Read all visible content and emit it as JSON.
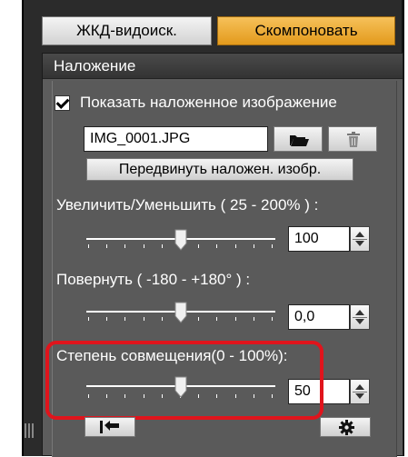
{
  "tabs": {
    "lcd": "ЖКД-видоиск.",
    "compose": "Скомпоновать"
  },
  "overlay": {
    "header": "Наложение",
    "show_overlay_label": "Показать наложенное изображение",
    "show_overlay_checked": true,
    "filename": "IMG_0001.JPG",
    "move_button": "Передвинуть наложен. изобр.",
    "zoom": {
      "label": "Увеличить/Уменьшить ( 25 - 200% ) :",
      "value": "100",
      "level_fraction": 0.5
    },
    "rotate": {
      "label": "Повернуть ( -180 - +180° ) :",
      "value": "0,0",
      "level_fraction": 0.5
    },
    "blend": {
      "label": "Степень совмещения(0 - 100%):",
      "value": "50",
      "level_fraction": 0.5
    }
  },
  "icons": {
    "open": "folder-open-icon",
    "delete": "trash-icon",
    "reset": "reset-arrow-icon",
    "settings": "gear-icon"
  },
  "colors": {
    "compose_tab": "#e39a1c",
    "highlight": "#e0141c",
    "panel": "#5a5a5a"
  }
}
